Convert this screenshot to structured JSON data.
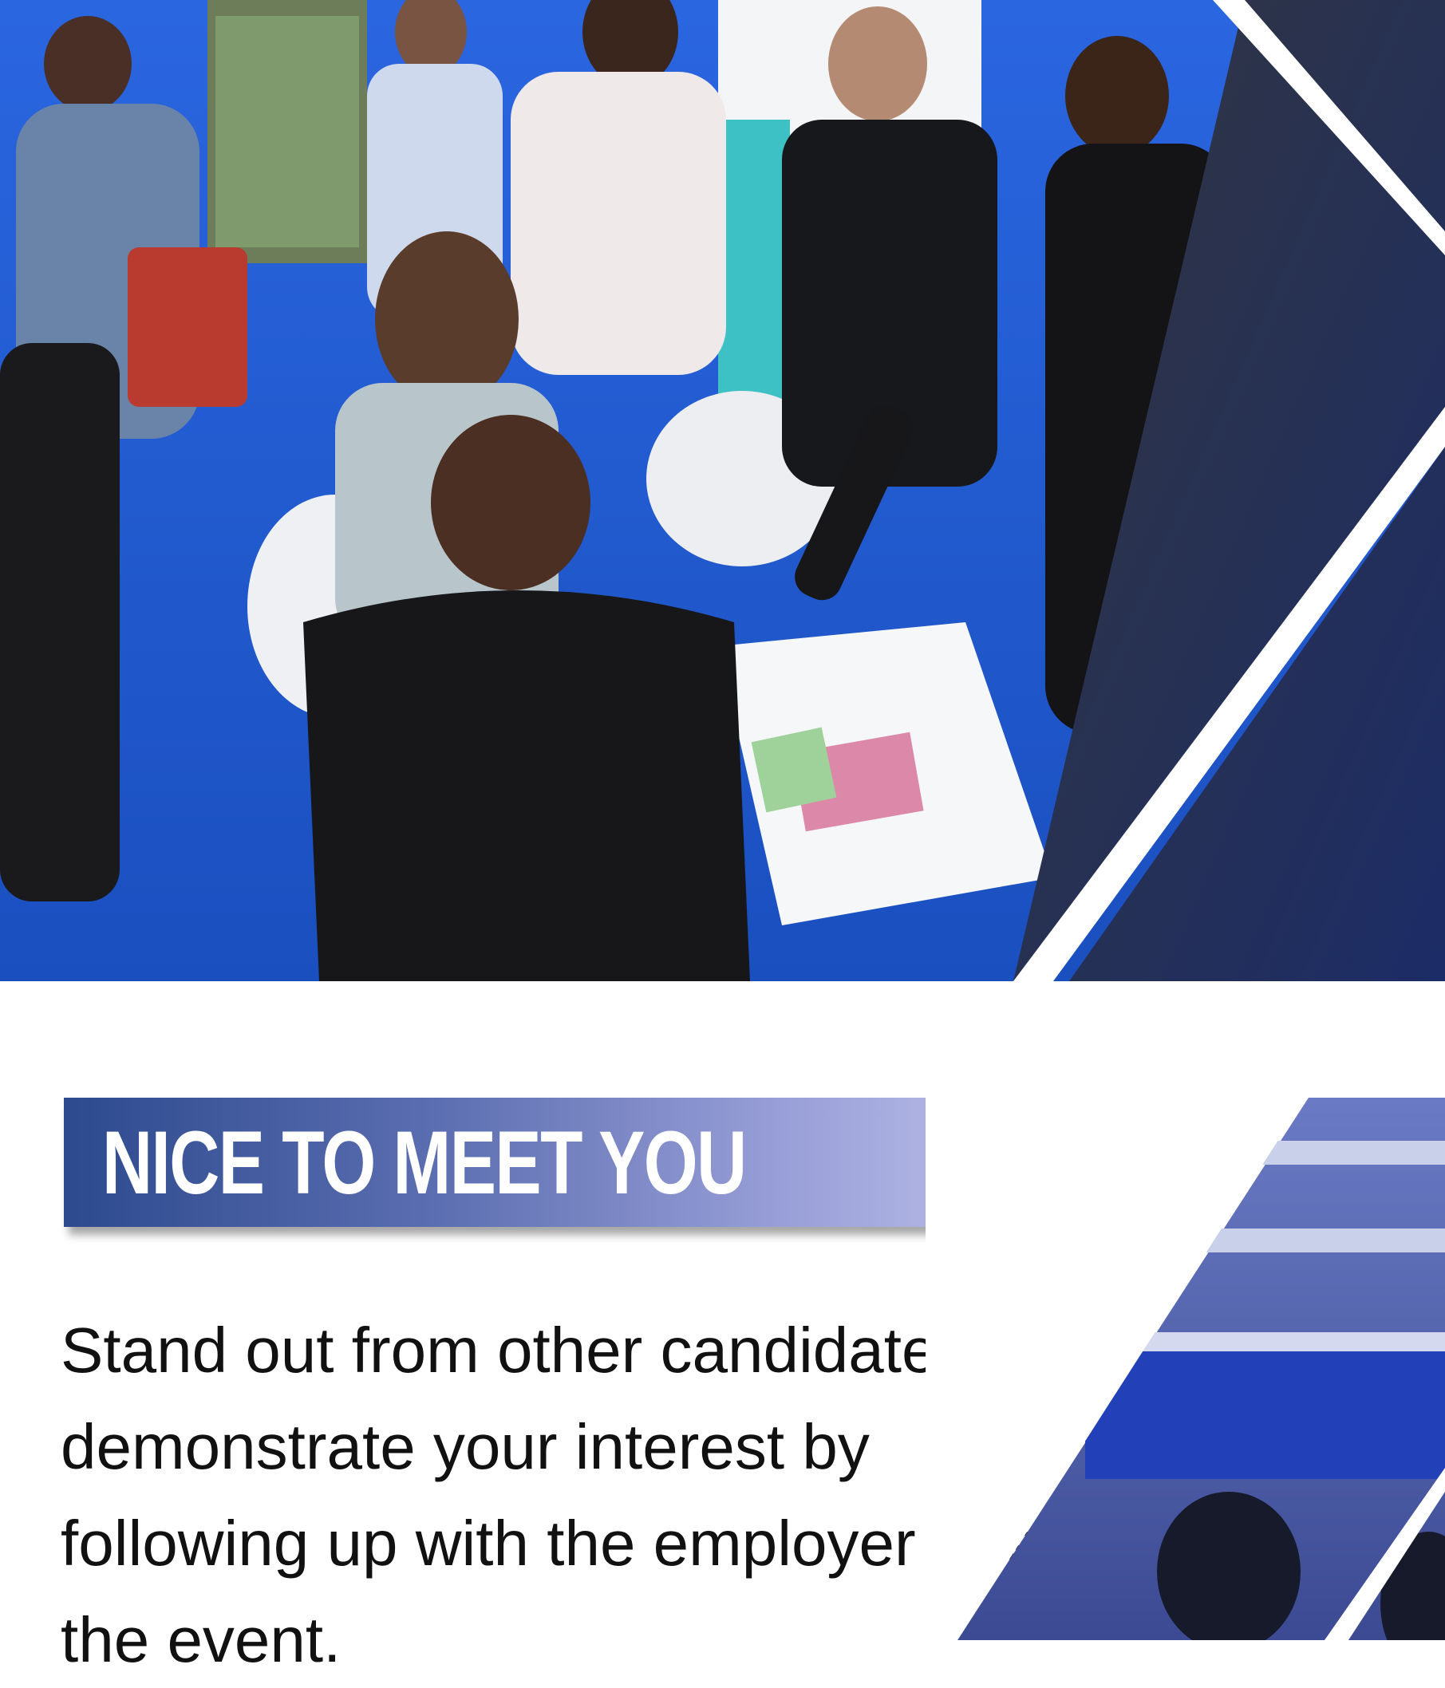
{
  "heading": {
    "title": "NICE TO MEET YOU"
  },
  "body": {
    "text": "Stand out from other candidates and demonstrate your interest by following up with the employer after the event."
  },
  "colors": {
    "banner_start": "#2d4a8e",
    "banner_end": "#c6c8ef",
    "accent_blue": "#1f5fd6"
  }
}
